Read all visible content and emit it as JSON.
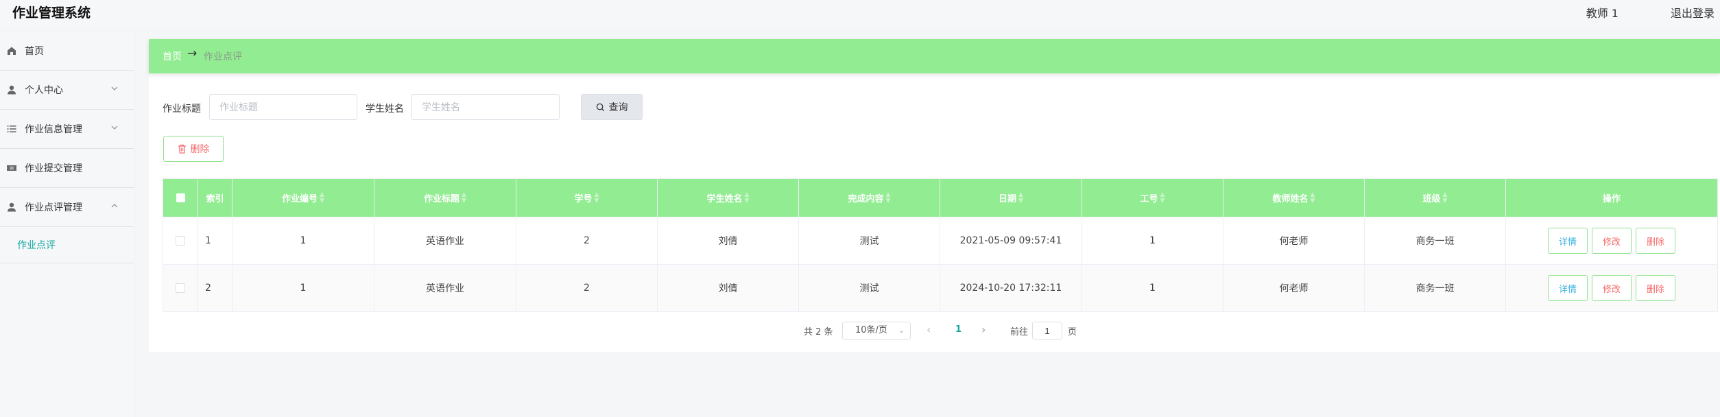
{
  "header": {
    "title": "作业管理系统",
    "user": "教师 1",
    "logout": "退出登录"
  },
  "sidebar": {
    "items": [
      {
        "label": "首页",
        "icon": "home-icon"
      },
      {
        "label": "个人中心",
        "icon": "user-icon"
      },
      {
        "label": "作业信息管理",
        "icon": "list-icon"
      },
      {
        "label": "作业提交管理",
        "icon": "ticket-icon"
      },
      {
        "label": "作业点评管理",
        "icon": "user-icon"
      }
    ],
    "sub_item": "作业点评"
  },
  "breadcrumb": {
    "home": "首页",
    "arrow": "→",
    "current": "作业点评"
  },
  "search": {
    "title_label": "作业标题",
    "title_placeholder": "作业标题",
    "name_label": "学生姓名",
    "name_placeholder": "学生姓名",
    "query_label": "查询"
  },
  "toolbar": {
    "delete_label": "删除"
  },
  "table": {
    "headers": [
      "索引",
      "作业编号",
      "作业标题",
      "学号",
      "学生姓名",
      "完成内容",
      "日期",
      "工号",
      "教师姓名",
      "班级",
      "操作"
    ],
    "rows": [
      {
        "index": "1",
        "hw_no": "1",
        "title": "英语作业",
        "student_no": "2",
        "student_name": "刘倩",
        "content": "测试",
        "date": "2021-05-09 09:57:41",
        "staff_no": "1",
        "teacher": "何老师",
        "class": "商务一班"
      },
      {
        "index": "2",
        "hw_no": "1",
        "title": "英语作业",
        "student_no": "2",
        "student_name": "刘倩",
        "content": "测试",
        "date": "2024-10-20 17:32:11",
        "staff_no": "1",
        "teacher": "何老师",
        "class": "商务一班"
      }
    ],
    "actions": {
      "detail": "详情",
      "edit": "修改",
      "remove": "删除"
    }
  },
  "pagination": {
    "total": "共 2 条",
    "page_size": "10条/页",
    "current": "1",
    "goto_label": "前往",
    "goto_value": "1",
    "page_label": "页"
  },
  "colors": {
    "accent_green": "#92ec92",
    "link_teal": "#11a6a0",
    "danger": "#f56c6c"
  }
}
